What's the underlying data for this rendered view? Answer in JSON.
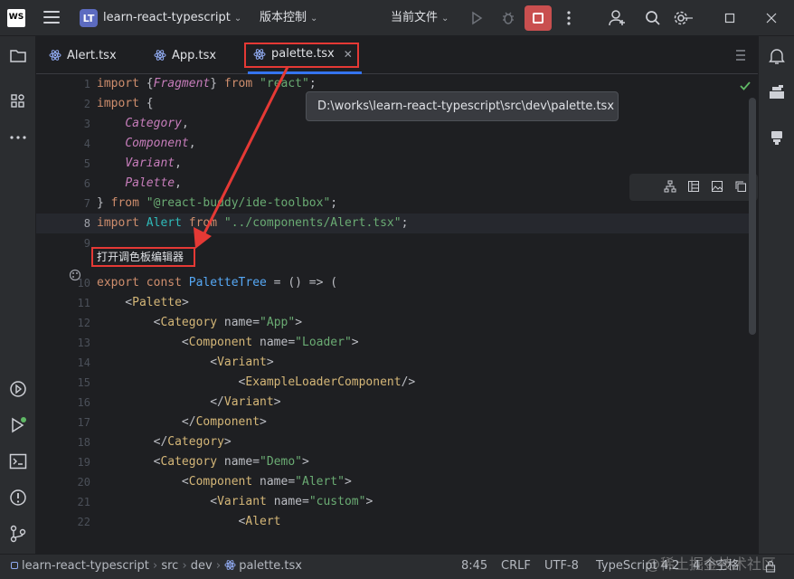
{
  "titlebar": {
    "logo": "WS",
    "project_badge": "LT",
    "project_name": "learn-react-typescript",
    "vcs_label": "版本控制",
    "run_config": "当前文件"
  },
  "tabs": [
    {
      "label": "Alert.tsx"
    },
    {
      "label": "App.tsx"
    },
    {
      "label": "palette.tsx",
      "active": true
    }
  ],
  "tooltip": "D:\\works\\learn-react-typescript\\src\\dev\\palette.tsx",
  "hint": "打开调色板编辑器",
  "gutter": [
    "1",
    "2",
    "3",
    "4",
    "5",
    "6",
    "7",
    "8",
    "9",
    "10",
    "11",
    "12",
    "13",
    "14",
    "15",
    "16",
    "17",
    "18",
    "19",
    "20",
    "21",
    "22"
  ],
  "code": [
    [
      [
        "kw",
        "import "
      ],
      [
        "txt",
        "{"
      ],
      [
        "it",
        "Fragment"
      ],
      [
        "txt",
        "} "
      ],
      [
        "kw",
        "from "
      ],
      [
        "str",
        "\"react\""
      ],
      [
        "txt",
        ";"
      ]
    ],
    [
      [
        "kw",
        "import "
      ],
      [
        "txt",
        "{"
      ]
    ],
    [
      [
        "txt",
        "    "
      ],
      [
        "it",
        "Category"
      ],
      [
        "txt",
        ","
      ]
    ],
    [
      [
        "txt",
        "    "
      ],
      [
        "it",
        "Component"
      ],
      [
        "txt",
        ","
      ]
    ],
    [
      [
        "txt",
        "    "
      ],
      [
        "it",
        "Variant"
      ],
      [
        "txt",
        ","
      ]
    ],
    [
      [
        "txt",
        "    "
      ],
      [
        "it",
        "Palette"
      ],
      [
        "txt",
        ","
      ]
    ],
    [
      [
        "txt",
        "} "
      ],
      [
        "kw",
        "from "
      ],
      [
        "str",
        "\"@react-buddy/ide-toolbox\""
      ],
      [
        "txt",
        ";"
      ]
    ],
    [
      [
        "kw",
        "import "
      ],
      [
        "cls",
        "Alert "
      ],
      [
        "kw",
        "from "
      ],
      [
        "str",
        "\"../components/Alert.tsx\""
      ],
      [
        "txt",
        ";"
      ]
    ],
    [
      [
        "txt",
        ""
      ]
    ],
    [
      [
        "kw",
        "export const "
      ],
      [
        "fn",
        "PaletteTree"
      ],
      [
        "txt",
        " = () => ("
      ]
    ],
    [
      [
        "txt",
        "    <"
      ],
      [
        "tag",
        "Palette"
      ],
      [
        "txt",
        ">"
      ]
    ],
    [
      [
        "txt",
        "        <"
      ],
      [
        "tag",
        "Category "
      ],
      [
        "attr",
        "name"
      ],
      [
        "txt",
        "="
      ],
      [
        "str",
        "\"App\""
      ],
      [
        "txt",
        ">"
      ]
    ],
    [
      [
        "txt",
        "            <"
      ],
      [
        "tag",
        "Component "
      ],
      [
        "attr",
        "name"
      ],
      [
        "txt",
        "="
      ],
      [
        "str",
        "\"Loader\""
      ],
      [
        "txt",
        ">"
      ]
    ],
    [
      [
        "txt",
        "                <"
      ],
      [
        "tag",
        "Variant"
      ],
      [
        "txt",
        ">"
      ]
    ],
    [
      [
        "txt",
        "                    <"
      ],
      [
        "tag",
        "ExampleLoaderComponent"
      ],
      [
        "txt",
        "/>"
      ]
    ],
    [
      [
        "txt",
        "                </"
      ],
      [
        "tag",
        "Variant"
      ],
      [
        "txt",
        ">"
      ]
    ],
    [
      [
        "txt",
        "            </"
      ],
      [
        "tag",
        "Component"
      ],
      [
        "txt",
        ">"
      ]
    ],
    [
      [
        "txt",
        "        </"
      ],
      [
        "tag",
        "Category"
      ],
      [
        "txt",
        ">"
      ]
    ],
    [
      [
        "txt",
        "        <"
      ],
      [
        "tag",
        "Category "
      ],
      [
        "attr",
        "name"
      ],
      [
        "txt",
        "="
      ],
      [
        "str",
        "\"Demo\""
      ],
      [
        "txt",
        ">"
      ]
    ],
    [
      [
        "txt",
        "            <"
      ],
      [
        "tag",
        "Component "
      ],
      [
        "attr",
        "name"
      ],
      [
        "txt",
        "="
      ],
      [
        "str",
        "\"Alert\""
      ],
      [
        "txt",
        ">"
      ]
    ],
    [
      [
        "txt",
        "                <"
      ],
      [
        "tag",
        "Variant "
      ],
      [
        "attr",
        "name"
      ],
      [
        "txt",
        "="
      ],
      [
        "str",
        "\"custom\""
      ],
      [
        "txt",
        ">"
      ]
    ],
    [
      [
        "txt",
        "                    <"
      ],
      [
        "tag",
        "Alert"
      ]
    ]
  ],
  "statusbar": {
    "crumbs": [
      "learn-react-typescript",
      "src",
      "dev",
      "palette.tsx"
    ],
    "position": "8:45",
    "line_sep": "CRLF",
    "encoding": "UTF-8",
    "lang": "TypeScript 4.2",
    "indent": "4 个空格"
  },
  "watermark": "@稀土掘金技术社区",
  "colors": {
    "accent": "#3574f0",
    "annotation": "#e53935",
    "stop": "#c94f4f"
  }
}
